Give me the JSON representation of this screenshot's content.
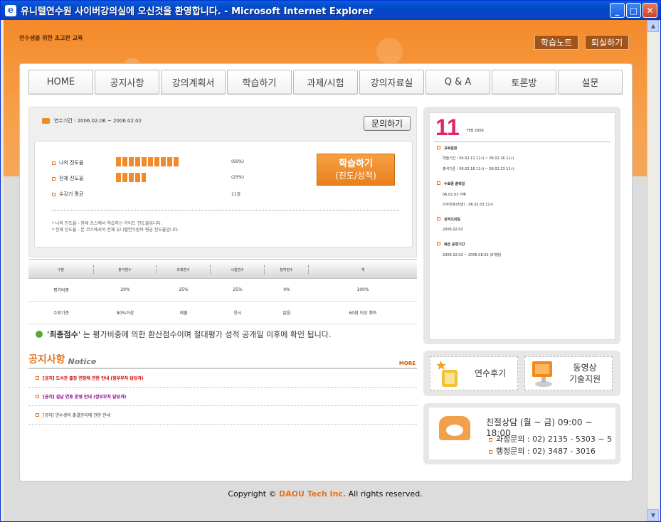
{
  "window": {
    "title": "유니텔연수원 사이버강의실에 오신것을 환영합니다. - Microsoft Internet Explorer"
  },
  "header": {
    "note": "연수생을 위한 초고판 교육",
    "btn_note": "학습노트",
    "btn_exit": "퇴실하기"
  },
  "nav": [
    "HOME",
    "공지사항",
    "강의계획서",
    "학습하기",
    "과제/시험",
    "강의자료실",
    "Q & A",
    "토론방",
    "설문"
  ],
  "course": {
    "period": "연수기간 :   2006.02.06 ~ 2006.02.02",
    "ask_button": "문의하기",
    "progress": [
      {
        "label": "나의 진도율",
        "value": 60,
        "pct": "(60%)"
      },
      {
        "label": "전체 진도율",
        "value": 25,
        "pct": "(25%)"
      },
      {
        "label": "수강기 평균",
        "value": 0,
        "pct": "11강"
      }
    ],
    "study_button": {
      "line1": "학습하기",
      "line2": "(진도/성적)"
    },
    "notes": [
      "* 나의 진도율 - 현재 코스에서 학습하신 가이드 진도율입니다.",
      "* 전체 진도율 - 본 코스에서의 전체 유니텔연수원의 평균 진도율입니다."
    ]
  },
  "scores": {
    "headers": [
      "구분",
      "출석점수",
      "과제점수",
      "시험점수",
      "참여점수",
      "계"
    ],
    "rows": [
      [
        "평가비중",
        "20%",
        "25%",
        "25%",
        "0%",
        "100%"
      ],
      [
        "수료기준",
        "80%이상",
        "제출",
        "응시",
        "없음",
        "60점 이상 취득"
      ]
    ]
  },
  "final_note_bold": "'최종점수'",
  "final_note_rest": " 는 평가비중에 의한 환산점수이며 절대평가 성적 공개일 이후에 확인 됩니다.",
  "notice": {
    "title_kr": "공지사항",
    "title_en": "Notice",
    "more": "MORE",
    "items": [
      {
        "text": "[공지] 도서관 출장 연장에 관한 안내 (정부부처 담당과)",
        "color": "#cc0000"
      },
      {
        "text": "[공지] 설날 연휴 운영 안내 (정부부처 담당과)",
        "color": "#8b008b"
      },
      {
        "text": "[공지] 연수생의 출결관리에 관한 안내",
        "color": "#333333"
      }
    ]
  },
  "calendar": {
    "day": "11",
    "month": "FEB 2006",
    "items": [
      {
        "head": "교육일정",
        "subs": [
          "학습기간 : 06.02.11 11시 ~ 06.02.16 11시",
          "출석기준 : 06.02.16 11시 ~ 06.02.23 11시"
        ]
      },
      {
        "head": "수료증 출력일",
        "subs": [
          "06.02.03 이후",
          "이수번호(비번) : 06.02.03 11시"
        ]
      },
      {
        "head": "성적조회일",
        "subs": [
          "2006.02.02"
        ]
      },
      {
        "head": "복습 운영기간",
        "subs": [
          "2006.02.02 ~ 2006.08.02 (6개월)"
        ]
      }
    ]
  },
  "quick": {
    "review": "연수후기",
    "video_line1": "동영상",
    "video_line2": "기술지원"
  },
  "contact": {
    "hours": "친절상담 (월 ~ 금) 09:00 ~ 18:00",
    "course": "과정문의 : 02) 2135 - 5303 ~ 5",
    "admin": "행정문의 : 02) 3487 - 3016"
  },
  "footer": {
    "prefix": "Copyright © ",
    "brand": "DAOU Tech Inc.",
    "suffix": " All rights reserved."
  }
}
